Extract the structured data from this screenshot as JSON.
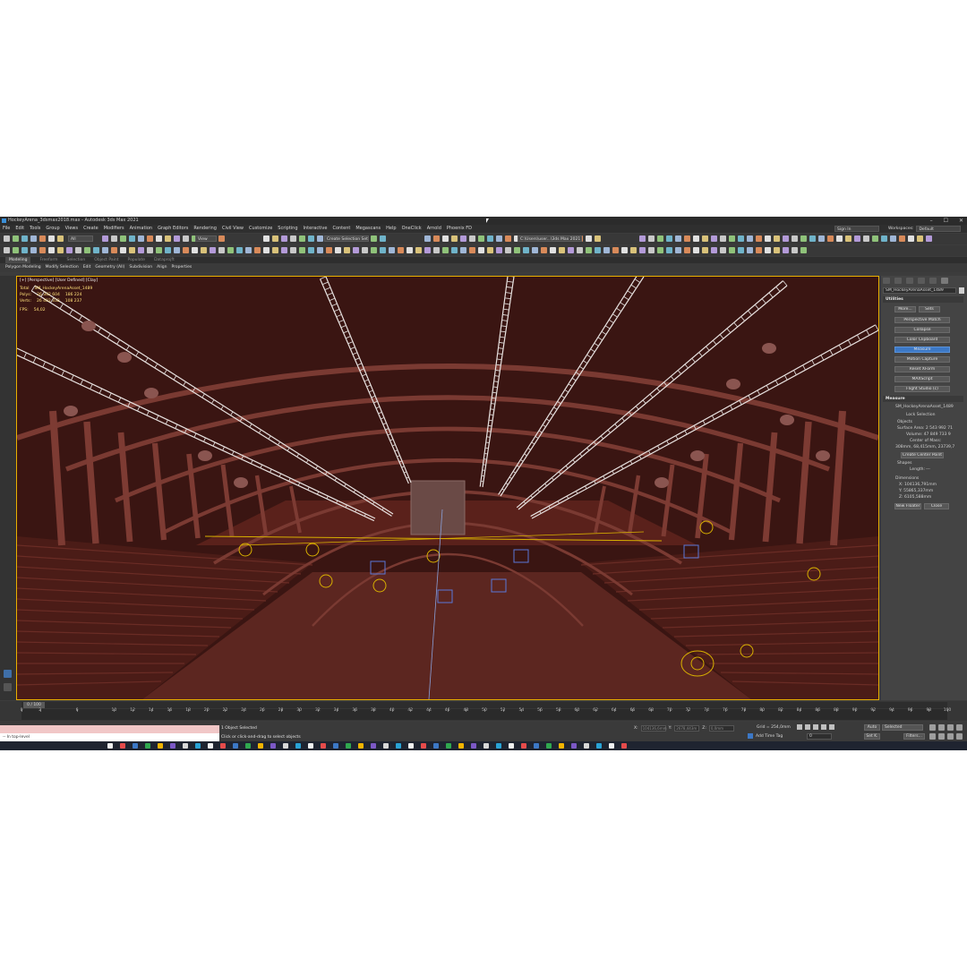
{
  "window": {
    "title": "HockeyArena_3dsmax2018.max - Autodesk 3ds Max 2021",
    "controls": [
      "–",
      "☐",
      "✕"
    ]
  },
  "menu": {
    "items": [
      "File",
      "Edit",
      "Tools",
      "Group",
      "Views",
      "Create",
      "Modifiers",
      "Animation",
      "Graph Editors",
      "Rendering",
      "Civil View",
      "Customize",
      "Scripting",
      "Interactive",
      "Content",
      "Megascans",
      "Help",
      "OneClick",
      "Arnold",
      "Phoenix FD"
    ],
    "sign_in": "Sign In",
    "workspaces_label": "Workspaces:",
    "workspace_value": "Default"
  },
  "toolbar": {
    "selection_filter": "All",
    "view_dropdown": "View",
    "selection_set": "Create Selection Set",
    "project_path": "C:\\Users\\user...\\3ds Max 2021"
  },
  "ribbon": {
    "tabs": [
      "Modeling",
      "Freeform",
      "Selection",
      "Object Paint",
      "Populate",
      "Dataprojft"
    ],
    "active_tab": "Modeling",
    "items": [
      "Polygon Modeling",
      "Modify Selection",
      "Edit",
      "Geometry (All)",
      "Subdivision",
      "Align",
      "Properties"
    ]
  },
  "viewport": {
    "label": "[+] [Perspective] [User Defined] [Clay]",
    "stats": {
      "total_label": "Total",
      "total_value": "SM_HockeyArenaAsset_1489",
      "polys_label": "Polys:",
      "polys_total": "26 342 604",
      "polys_sel": "186 224",
      "verts_label": "Verts:",
      "verts_total": "26 402 332",
      "verts_sel": "108 237",
      "fps_label": "FPS:",
      "fps_value": "54,02"
    }
  },
  "command_panel": {
    "object_name": "SM_HockeyArenaAsset_1489",
    "utilities_title": "Utilities",
    "more_button": "More...",
    "sets_button": "Sets",
    "utility_buttons": [
      "Perspective Match",
      "Collapse",
      "Color Clipboard",
      "Measure",
      "Motion Capture",
      "Reset XForm",
      "MAXScript",
      "Flight Studio (c)"
    ],
    "active_utility": "Measure",
    "measure_title": "Measure",
    "measure_object": "SM_HockeyArenaAsset_1489",
    "lock_selection": "Lock Selection",
    "objects_label": "Objects",
    "surface_area": "Surface Area:  2 543 992 71",
    "volume": "Volume:  47 849 733 9",
    "center_of_mass_label": "Center of Mass:",
    "center_of_mass": "308mm, 68,415mm, 23739,7",
    "create_center_point": "Create Center Point",
    "shapes_label": "Shapes",
    "length_label": "Length:",
    "length_value": "---",
    "dimensions_label": "Dimensions",
    "dim_x": "X:  104136,791mm",
    "dim_y": "Y:  55865,337mm",
    "dim_z": "Z:  6105,588mm",
    "new_floater": "New Floater",
    "close": "Close"
  },
  "timeline": {
    "slider_label": "0 / 100",
    "ticks": [
      "0",
      "2",
      "6",
      "10",
      "12",
      "14",
      "16",
      "18",
      "20",
      "22",
      "24",
      "26",
      "28",
      "30",
      "32",
      "34",
      "36",
      "38",
      "40",
      "42",
      "44",
      "46",
      "48",
      "50",
      "52",
      "54",
      "56",
      "58",
      "60",
      "62",
      "64",
      "66",
      "68",
      "70",
      "72",
      "74",
      "76",
      "78",
      "80",
      "82",
      "84",
      "86",
      "88",
      "90",
      "92",
      "94",
      "96",
      "98",
      "100"
    ]
  },
  "status": {
    "maxscript_input": "-- In top-level",
    "selected": "1 Object Selected",
    "prompt": "Click or click-and-drag to select objects",
    "x_label": "X:",
    "x_value": "104136,6mm",
    "y_label": "Y:",
    "y_value": "2678,443m",
    "z_label": "Z:",
    "z_value": "0,0mm",
    "grid": "Grid = 254,0mm",
    "add_time_tag": "Add Time Tag",
    "frame_value": "0",
    "auto_key": "Auto",
    "set_key": "Set K.",
    "selected_dd": "Selected",
    "filters": "Filters..."
  },
  "colors": {
    "viewport_bg": "#4a1a16",
    "accent_blue": "#3c78c6",
    "selection_yellow": "#e8b000"
  }
}
